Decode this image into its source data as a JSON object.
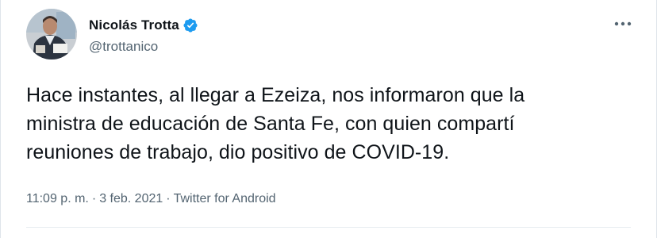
{
  "author": {
    "display_name": "Nicolás Trotta",
    "handle": "@trottanico",
    "verified": true,
    "avatar_icon": "profile-photo"
  },
  "menu_icon": "more-horizontal-icon",
  "tweet": {
    "text": "Hace instantes, al llegar a Ezeiza, nos informaron que la\nministra de educación de Santa Fe, con quien compartí\nreuniones de trabajo, dio positivo de COVID-19."
  },
  "meta": {
    "time": "11:09 p. m.",
    "separator": "·",
    "date": "3 feb. 2021",
    "source": "Twitter for Android"
  },
  "colors": {
    "text": "#0f1419",
    "secondary": "#536471",
    "verified_blue": "#1d9bf0"
  }
}
